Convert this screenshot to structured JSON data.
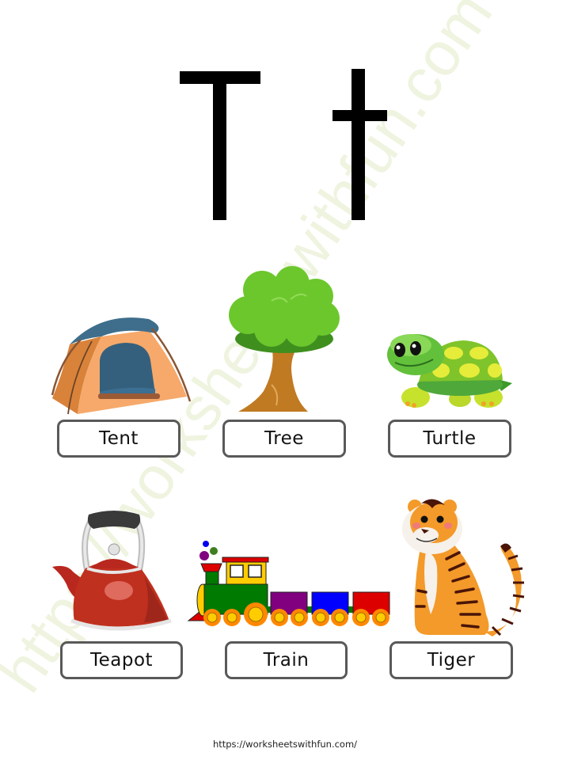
{
  "worksheet": {
    "uppercase_letter": "T",
    "lowercase_letter": "t",
    "watermark_text": "https://worksheetswithfun.com",
    "footer_url": "https://worksheetswithfun.com/"
  },
  "items": [
    {
      "label": "Tent",
      "icon": "tent-icon"
    },
    {
      "label": "Tree",
      "icon": "tree-icon"
    },
    {
      "label": "Turtle",
      "icon": "turtle-icon"
    },
    {
      "label": "Teapot",
      "icon": "teapot-icon"
    },
    {
      "label": "Train",
      "icon": "train-icon"
    },
    {
      "label": "Tiger",
      "icon": "tiger-icon"
    }
  ],
  "colors": {
    "letter": "#000000",
    "label_border": "#595959",
    "watermark": "#eef4df"
  }
}
